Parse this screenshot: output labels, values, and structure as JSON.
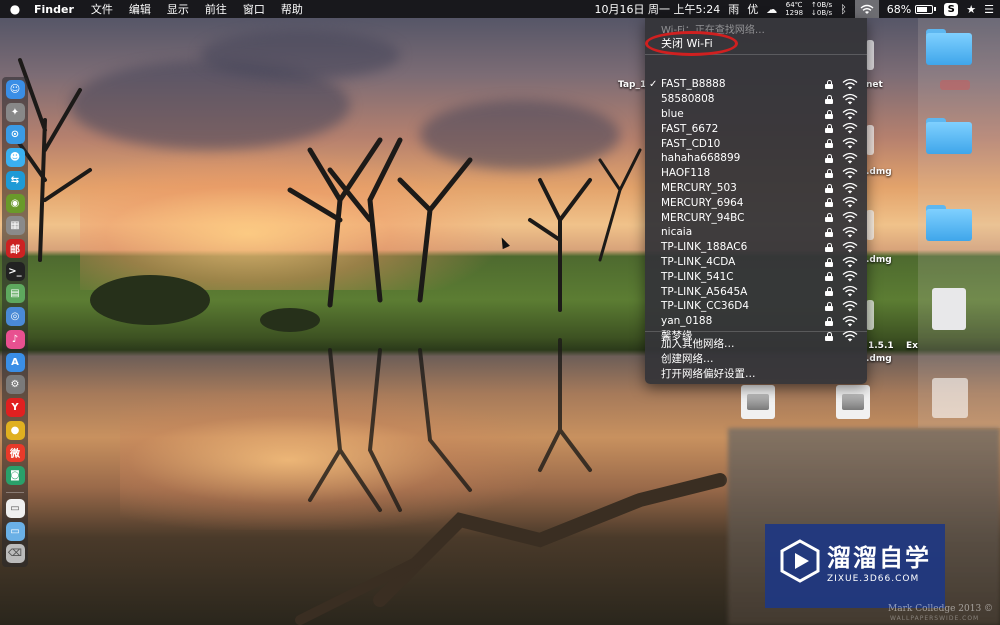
{
  "menubar": {
    "apple_icon": "apple-icon",
    "app_name": "Finder",
    "menus": [
      "文件",
      "编辑",
      "显示",
      "前往",
      "窗口",
      "帮助"
    ],
    "clock": "10月16日 周一 上午5:24",
    "weather": "雨",
    "weather_extra": "优",
    "temperature": "64℃",
    "rpm": "1298",
    "net_up": "0B/s",
    "net_down": "0B/s",
    "battery_percent": "68%",
    "battery_level": 0.68,
    "s_badge": "S"
  },
  "wifi_menu": {
    "status": "Wi-Fi：正在查找网络…",
    "turn_off": "关闭 Wi-Fi",
    "highlight_color": "#d02020",
    "networks": [
      {
        "name": "FAST_B8888",
        "checked": true
      },
      {
        "name": "58580808",
        "checked": false
      },
      {
        "name": "blue",
        "checked": false
      },
      {
        "name": "FAST_6672",
        "checked": false
      },
      {
        "name": "FAST_CD10",
        "checked": false
      },
      {
        "name": "hahaha668899",
        "checked": false
      },
      {
        "name": "HAOF118",
        "checked": false
      },
      {
        "name": "MERCURY_503",
        "checked": false
      },
      {
        "name": "MERCURY_6964",
        "checked": false
      },
      {
        "name": "MERCURY_94BC",
        "checked": false
      },
      {
        "name": "nicaia",
        "checked": false
      },
      {
        "name": "TP-LINK_188AC6",
        "checked": false
      },
      {
        "name": "TP-LINK_4CDA",
        "checked": false
      },
      {
        "name": "TP-LINK_541C",
        "checked": false
      },
      {
        "name": "TP-LINK_A5645A",
        "checked": false
      },
      {
        "name": "TP-LINK_CC36D4",
        "checked": false
      },
      {
        "name": "yan_0188",
        "checked": false
      },
      {
        "name": "馨梦缘",
        "checked": false
      }
    ],
    "checkmark": "✓",
    "join_other": "加入其他网络…",
    "create_network": "创建网络…",
    "open_prefs": "打开网络偏好设置…"
  },
  "desktop": {
    "labels": {
      "tap": "Tap_1",
      "net": "net",
      "dmg1": ".dmg",
      "dmg2": ".dmg",
      "ver": "1.5.1",
      "ex": "Ex",
      "dmg3": ".dmg"
    }
  },
  "dock": {
    "icons": [
      "finder-icon",
      "launchpad-icon",
      "safari-icon",
      "contacts-icon",
      "migration-icon",
      "android-icon",
      "tiles-icon",
      "netease-icon",
      "terminal-icon",
      "preview-icon",
      "siri-icon",
      "itunes-icon",
      "appstore-icon",
      "preferences-icon",
      "yandex-icon",
      "chrome-icon",
      "weibo-icon",
      "app-green-icon",
      "document-icon",
      "folder-icon",
      "trash-icon"
    ],
    "colors": [
      "#3a8ee6",
      "#888888",
      "#3a9be6",
      "#3bb0f0",
      "#1e9ad6",
      "#6a9a2a",
      "#8a8a8a",
      "#cc2222",
      "#222222",
      "#5ea85e",
      "#4a8ad6",
      "#e85090",
      "#3a8ee6",
      "#7a7a7a",
      "#e02020",
      "#e0b020",
      "#e83a2a",
      "#2aa06a",
      "#f0f0f0",
      "#6ab0e6",
      "#bbbbbb"
    ],
    "glyphs": [
      "☺",
      "✦",
      "⊙",
      "☻",
      "⇆",
      "◉",
      "▦",
      "邮",
      ">_",
      "▤",
      "◎",
      "♪",
      "A",
      "⚙",
      "Y",
      "●",
      "微",
      "◙",
      "▭",
      "▭",
      "⌫"
    ]
  },
  "watermark": {
    "title": "溜溜自学",
    "url": "ZIXUE.3D66.COM",
    "credit": "Mark Colledge 2013 ©",
    "site": "WALLPAPERSWIDE.COM"
  }
}
